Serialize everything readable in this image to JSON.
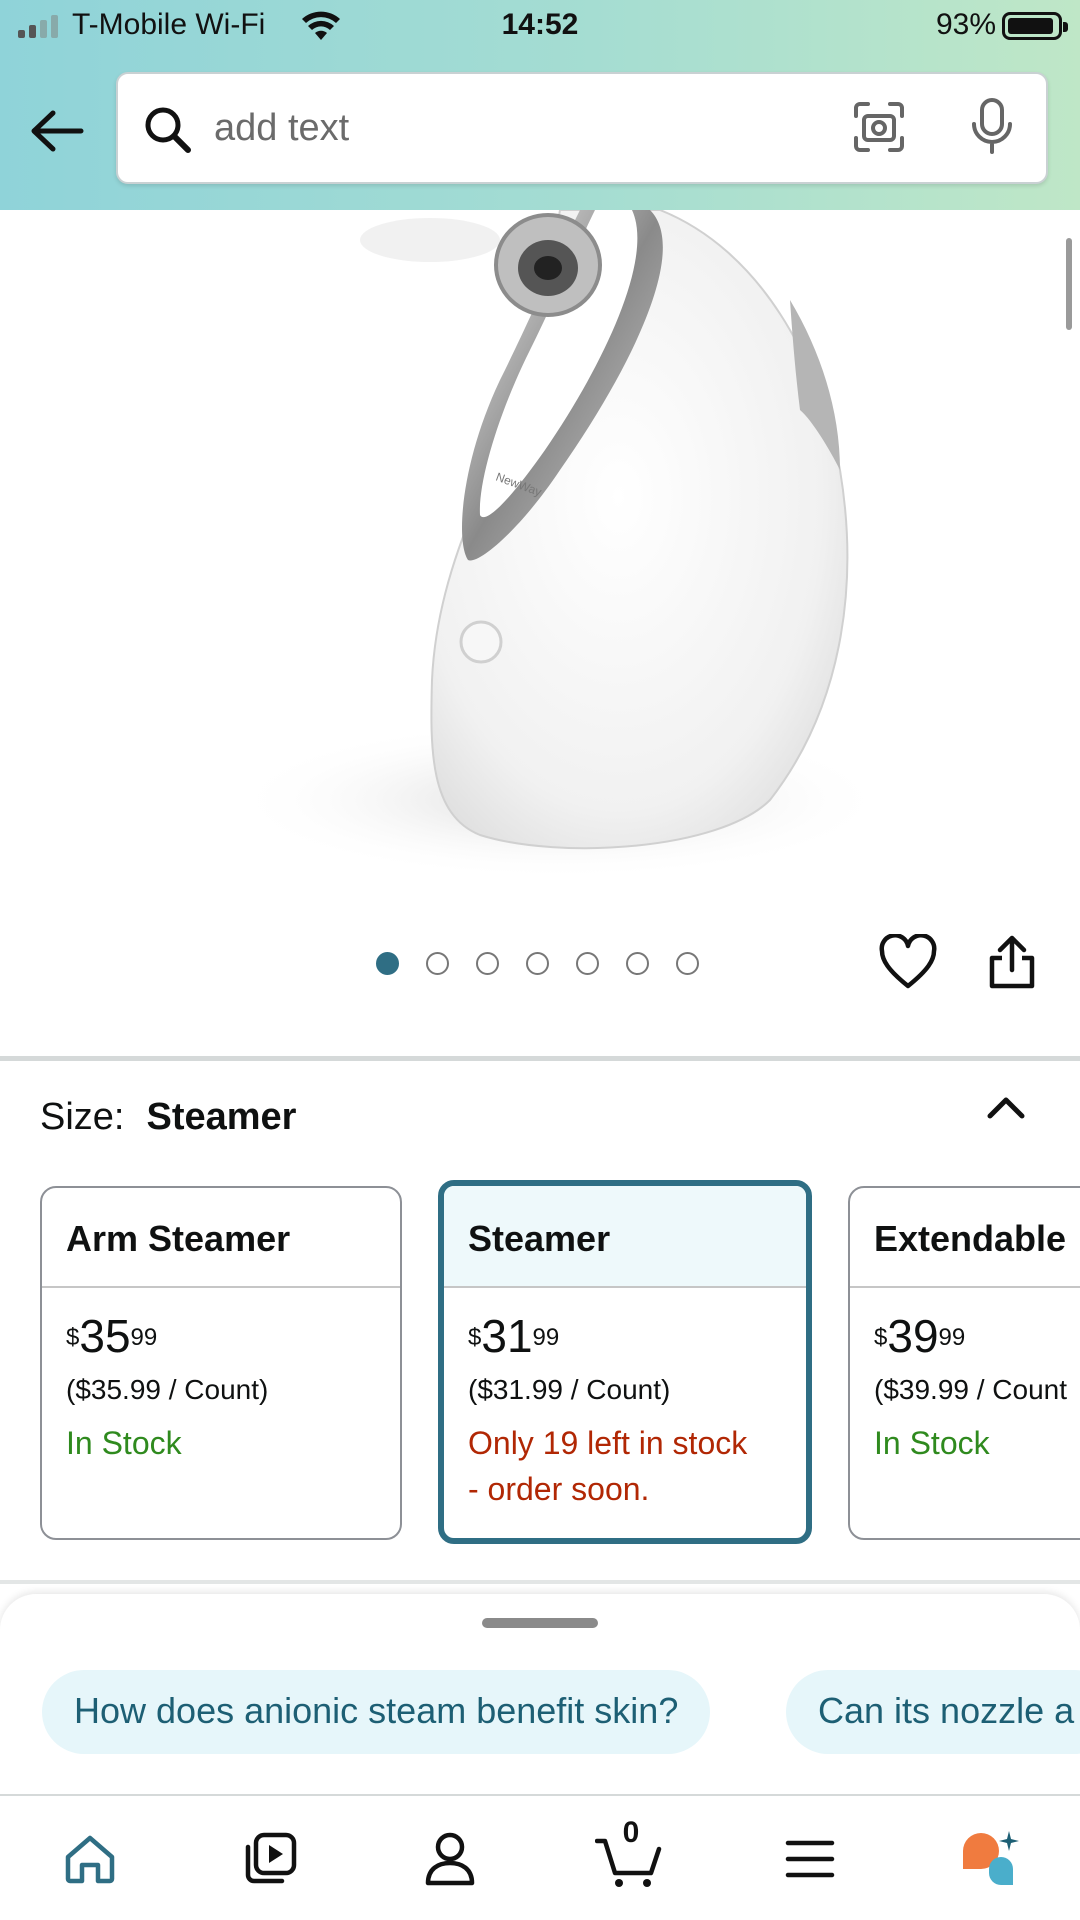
{
  "status_bar": {
    "carrier": "T-Mobile Wi-Fi",
    "time": "14:52",
    "battery": "93%",
    "battery_level": 0.93
  },
  "search": {
    "placeholder": "add text"
  },
  "product": {
    "image_brand_text": "NewWay",
    "image_count": 7,
    "active_image_index": 0
  },
  "size_selector": {
    "label": "Size:",
    "selected": "Steamer",
    "options": [
      {
        "name": "Arm Steamer",
        "currency": "$",
        "price_whole": "35",
        "price_cents": "99",
        "unit_price": "($35.99 / Count)",
        "stock": "In Stock",
        "stock_status": "in-stock"
      },
      {
        "name": "Steamer",
        "currency": "$",
        "price_whole": "31",
        "price_cents": "99",
        "unit_price": "($31.99 / Count)",
        "stock_line1": "Only 19 left in stock",
        "stock_line2": "- order soon.",
        "stock_status": "low-stock"
      },
      {
        "name": "Extendable",
        "currency": "$",
        "price_whole": "39",
        "price_cents": "99",
        "unit_price": "($39.99 / Count",
        "stock": "In Stock",
        "stock_status": "in-stock"
      }
    ]
  },
  "rufus": {
    "suggestions": [
      "How does anionic steam benefit skin?",
      "Can its nozzle a"
    ]
  },
  "bottom_nav": {
    "items": [
      "home-icon",
      "video-icon",
      "account-icon",
      "cart-icon",
      "menu-icon",
      "rufus-icon"
    ],
    "cart_count": "0"
  },
  "colors": {
    "accent": "#2f6e84",
    "in_stock": "#2f8a1e",
    "low_stock": "#b12704",
    "chip_bg": "#e6f6fa",
    "chip_text": "#1d5f74"
  }
}
